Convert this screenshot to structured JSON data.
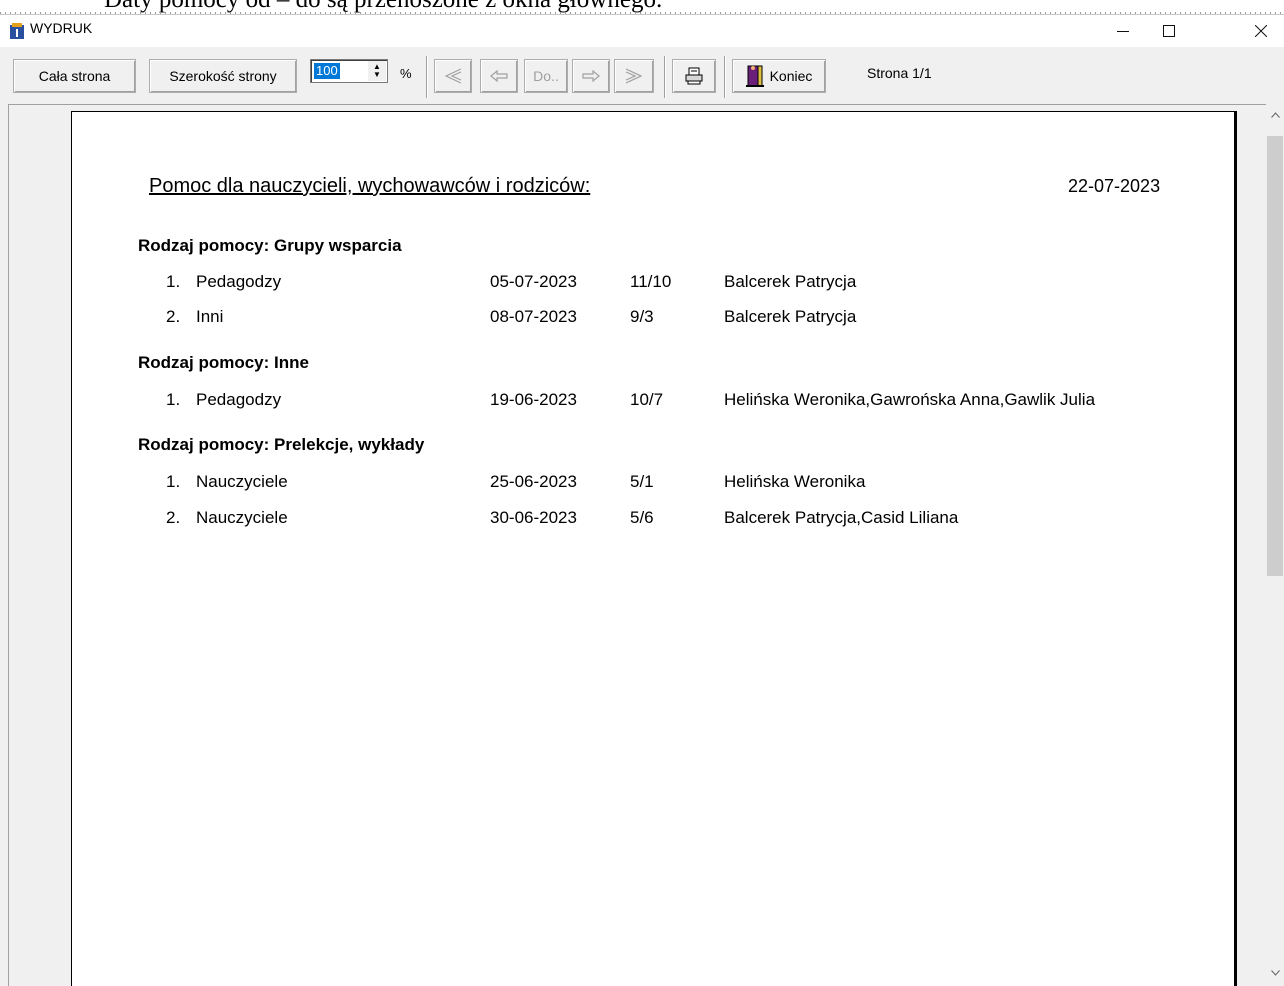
{
  "background_text": "Daty pomocy od – do są przenoszone z okna głównego.",
  "window": {
    "title": "WYDRUK"
  },
  "toolbar": {
    "full_page_label": "Cała strona",
    "page_width_label": "Szerokość strony",
    "zoom_value": "100",
    "zoom_unit": "%",
    "goto_label": "Do..",
    "end_label": "Koniec",
    "page_status": "Strona 1/1"
  },
  "report": {
    "title": "Pomoc dla nauczycieli, wychowawców i rodziców:",
    "date": "22-07-2023",
    "sections": [
      {
        "heading": "Rodzaj pomocy:  Grupy wsparcia",
        "rows": [
          {
            "num": "1.",
            "name": "Pedagodzy",
            "date": "05-07-2023",
            "code": "11/10",
            "persons": "Balcerek Patrycja"
          },
          {
            "num": "2.",
            "name": "Inni",
            "date": "08-07-2023",
            "code": "9/3",
            "persons": "Balcerek Patrycja"
          }
        ]
      },
      {
        "heading": "Rodzaj pomocy:  Inne",
        "rows": [
          {
            "num": "1.",
            "name": "Pedagodzy",
            "date": "19-06-2023",
            "code": "10/7",
            "persons": "Helińska Weronika,Gawrońska Anna,Gawlik Julia"
          }
        ]
      },
      {
        "heading": "Rodzaj pomocy:  Prelekcje, wykłady",
        "rows": [
          {
            "num": "1.",
            "name": "Nauczyciele",
            "date": "25-06-2023",
            "code": "5/1",
            "persons": "Helińska Weronika"
          },
          {
            "num": "2.",
            "name": "Nauczyciele",
            "date": "30-06-2023",
            "code": "5/6",
            "persons": "Balcerek Patrycja,Casid Liliana"
          }
        ]
      }
    ]
  },
  "icons": {
    "app": "app-icon",
    "minimize": "minimize-icon",
    "maximize": "maximize-icon",
    "close": "close-icon",
    "first_page": "first-page-icon",
    "prev_page": "prev-page-icon",
    "next_page": "next-page-icon",
    "last_page": "last-page-icon",
    "print": "printer-icon",
    "exit": "exit-door-icon"
  }
}
